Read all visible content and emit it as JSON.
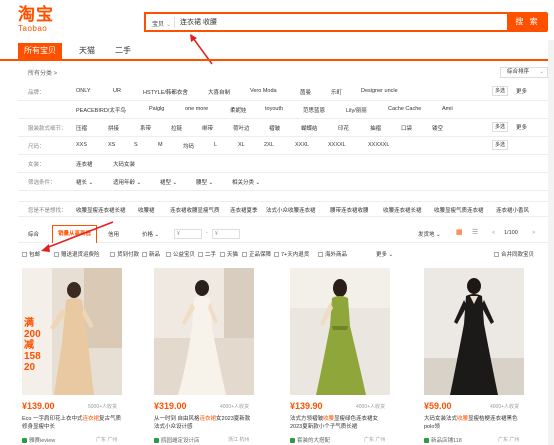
{
  "logo": {
    "cn": "淘宝",
    "en": "Taobao"
  },
  "search": {
    "category": "宝贝",
    "query": "连衣裙 收腰",
    "button": "搜 索"
  },
  "tabs": [
    "所有宝贝",
    "天猫",
    "二手"
  ],
  "crumb": "所有分类 >",
  "sort_select": "综合排序",
  "attributes": [
    {
      "label": "品牌：",
      "values": [
        "ONLY",
        "UR",
        "HSTYLE/韩都衣舍",
        "大喜自制",
        "Vero Moda",
        "茵曼",
        "乐町",
        "Designer uncle"
      ]
    },
    {
      "label": "",
      "values": [
        "PEACEBIRD/太平鸟",
        "Palglg",
        "one more",
        "柔妮娃",
        "toyouth",
        "范思蓝恩",
        "Lily/丽丽",
        "Cache Cache",
        "Amii"
      ]
    },
    {
      "label": "服装款式细节：",
      "values": [
        "压褶",
        "拼接",
        "系带",
        "拉链",
        "绑带",
        "荷叶边",
        "褶皱",
        "蝴蝶结",
        "印花",
        "抽褶",
        "口袋",
        "镂空"
      ]
    },
    {
      "label": "尺码：",
      "values": [
        "XXS",
        "XS",
        "S",
        "M",
        "均码",
        "L",
        "XL",
        "2XL",
        "XXXL",
        "XXXXL",
        "XXXXXL"
      ]
    },
    {
      "label": "女装：",
      "values": [
        "连衣裙",
        "大码女装"
      ]
    },
    {
      "label": "筛选条件：",
      "values": [
        "裙长",
        "适用年龄",
        "裙型",
        "腰型",
        "相关分类"
      ]
    }
  ],
  "multi_label": "多选",
  "more_label": "更多",
  "related": {
    "label": "您是不是想找：",
    "values": [
      "收腰显瘦连衣裙长裙",
      "收腰裙",
      "连衣裙收腰显瘦气质",
      "连衣裙夏季",
      "法式小众收腰连衣裙",
      "腰带连衣裙收腰",
      "收腰连衣裙长裙",
      "收腰显瘦气质连衣裙",
      "连衣裙小香风"
    ]
  },
  "sortbar": {
    "items": [
      "综合",
      "销量从高到低",
      "信用",
      "价格"
    ],
    "price_placeholder": "¥",
    "ship_label": "发货地",
    "page": "1/100"
  },
  "filters": [
    "包邮",
    "赠送退货运费险",
    "货到付款",
    "新品",
    "公益宝贝",
    "二手",
    "天猫",
    "正品保障",
    "7+天内退货",
    "海外商品"
  ],
  "filters_more": "更多",
  "filters_merge": "合并同款宝贝",
  "products": [
    {
      "price": "¥139.00",
      "sales": "5000+人收货",
      "title_pre": "Eco 一字肩印花上衣中式",
      "title_hl": "连衣裙",
      "title_post": "复古气质修身显瘦中长",
      "shop": "雅赛ieview",
      "loc": "广东 广州",
      "promo_nums": [
        "200",
        "158",
        "20"
      ]
    },
    {
      "price": "¥319.00",
      "sales": "4000+人收货",
      "title_pre": "从一时到 自由风格",
      "title_hl": "连衣裙",
      "title_post": "女2023夏新款法式小众设计感",
      "shop": "鸥园雌定设计店",
      "loc": "浙江 杭州"
    },
    {
      "price": "¥139.90",
      "sales": "4000+人收货",
      "title_pre": "法式方领褶皱",
      "title_hl": "收腰",
      "title_post": "显瘦绿色连衣裙女2023夏新款小个子气质长裙",
      "shop": "套装的大搭配",
      "loc": "广东 广州"
    },
    {
      "price": "¥59.00",
      "sales": "4000+人收货",
      "title_pre": "大码女装法式",
      "title_hl": "收腰",
      "title_post": "显瘦桔梗连衣裙黑色polo领",
      "shop": "新品店铺118",
      "loc": "广东 广州"
    }
  ],
  "colors": {
    "accent": "#ff5000",
    "border": "#dddddd"
  }
}
